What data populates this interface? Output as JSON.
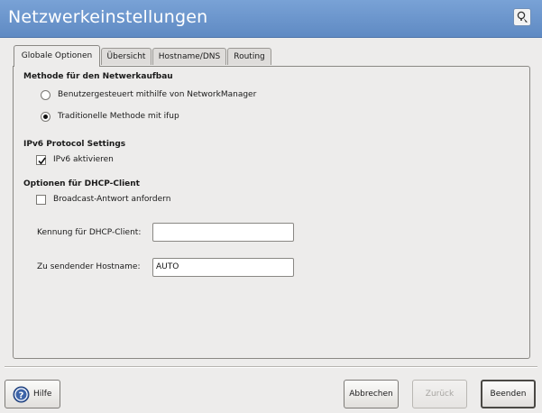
{
  "window": {
    "title": "Netzwerkeinstellungen",
    "help_icon": "question-help-icon"
  },
  "tabs": [
    {
      "label": "Globale Optionen",
      "active": true
    },
    {
      "label": "Übersicht",
      "active": false
    },
    {
      "label": "Hostname/DNS",
      "active": false
    },
    {
      "label": "Routing",
      "active": false
    }
  ],
  "setup_method": {
    "heading": "Methode für den Netwerkaufbau",
    "options": [
      {
        "label": "Benutzergesteuert mithilfe von NetworkManager",
        "selected": false
      },
      {
        "label": "Traditionelle Methode mit ifup",
        "selected": true
      }
    ]
  },
  "ipv6": {
    "heading": "IPv6 Protocol Settings",
    "enable_label": "IPv6 aktivieren",
    "enabled": true
  },
  "dhcp": {
    "heading": "Optionen für DHCP-Client",
    "broadcast_label": "Broadcast-Antwort anfordern",
    "broadcast_checked": false,
    "client_id_label": "Kennung für DHCP-Client:",
    "client_id_value": "",
    "hostname_label": "Zu sendender Hostname:",
    "hostname_value": "AUTO"
  },
  "buttons": {
    "help": "Hilfe",
    "cancel": "Abbrechen",
    "back": "Zurück",
    "finish": "Beenden"
  }
}
